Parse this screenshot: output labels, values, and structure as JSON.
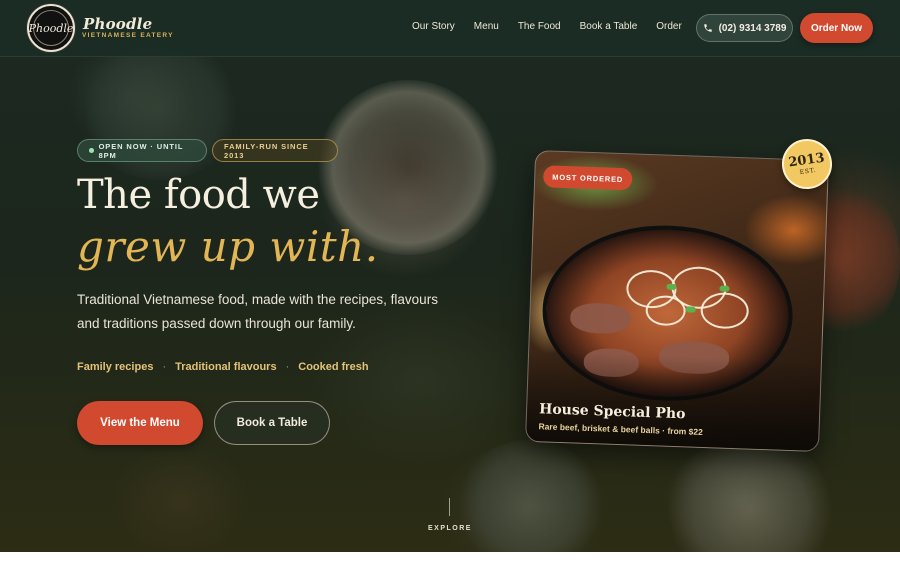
{
  "brand": {
    "name": "Phoodle",
    "tagline": "VIETNAMESE EATERY",
    "logo_script": "Phoodle",
    "logo_icon": "restaurant-logo-badge"
  },
  "nav": {
    "links": [
      "Our Story",
      "Menu",
      "The Food",
      "Book a Table",
      "Order"
    ],
    "phone": "(02) 9314 3789",
    "phone_icon": "phone-icon",
    "order_cta": "Order Now"
  },
  "hero": {
    "status_pill": "OPEN NOW · UNTIL 8PM",
    "family_pill": "FAMILY-RUN SINCE 2013",
    "headline_line1": "The food we",
    "headline_line2": "grew up with.",
    "lead": "Traditional Vietnamese food, made with the recipes, flavours and traditions passed down through our family.",
    "features": [
      "Family recipes",
      "Traditional flavours",
      "Cooked fresh"
    ],
    "separator": "·",
    "primary_cta": "View the Menu",
    "secondary_cta": "Book a Table"
  },
  "featured": {
    "badge": "MOST ORDERED",
    "title": "House Special Pho",
    "subtitle": "Rare beef, brisket & beef balls · from $22",
    "seal_year": "2013",
    "seal_label": "EST."
  },
  "scroll": {
    "label": "EXPLORE"
  },
  "colors": {
    "accent": "#d14a2f",
    "gold": "#e2b555",
    "nav_bg": "#1a2c24",
    "hero_bg": "#1c261c"
  }
}
